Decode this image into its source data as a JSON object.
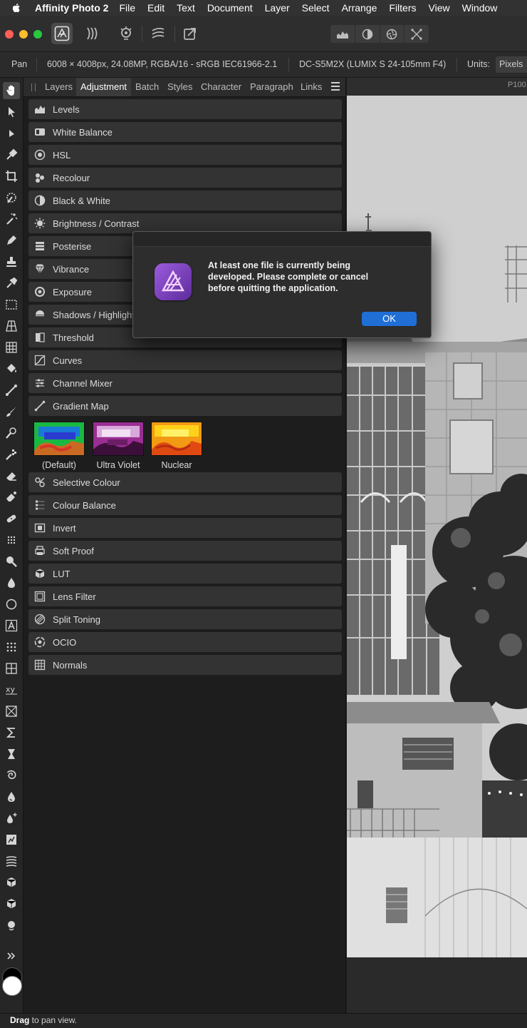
{
  "menubar": {
    "app_name": "Affinity Photo 2",
    "items": [
      "File",
      "Edit",
      "Text",
      "Document",
      "Layer",
      "Select",
      "Arrange",
      "Filters",
      "View",
      "Window"
    ]
  },
  "context": {
    "tool": "Pan",
    "doc_info": "6008 × 4008px, 24.08MP, RGBA/16 - sRGB IEC61966-2.1",
    "camera": "DC-S5M2X (LUMIX S 24-105mm F4)",
    "units_label": "Units:",
    "units_value": "Pixels"
  },
  "panel": {
    "tabs": [
      "Layers",
      "Adjustment",
      "Batch",
      "Styles",
      "Character",
      "Paragraph",
      "Links"
    ],
    "active_tab": "Adjustment",
    "adjustments": [
      {
        "label": "Levels",
        "icon": "levels-icon"
      },
      {
        "label": "White Balance",
        "icon": "white-balance-icon"
      },
      {
        "label": "HSL",
        "icon": "hsl-icon"
      },
      {
        "label": "Recolour",
        "icon": "recolour-icon"
      },
      {
        "label": "Black & White",
        "icon": "black-white-icon"
      },
      {
        "label": "Brightness / Contrast",
        "icon": "brightness-contrast-icon"
      },
      {
        "label": "Posterise",
        "icon": "posterise-icon"
      },
      {
        "label": "Vibrance",
        "icon": "vibrance-icon"
      },
      {
        "label": "Exposure",
        "icon": "exposure-icon"
      },
      {
        "label": "Shadows / Highlights",
        "icon": "shadows-highlights-icon"
      },
      {
        "label": "Threshold",
        "icon": "threshold-icon"
      },
      {
        "label": "Curves",
        "icon": "curves-icon"
      },
      {
        "label": "Channel Mixer",
        "icon": "channel-mixer-icon"
      },
      {
        "label": "Gradient Map",
        "icon": "gradient-map-icon"
      },
      {
        "label": "Selective Colour",
        "icon": "selective-colour-icon"
      },
      {
        "label": "Colour Balance",
        "icon": "colour-balance-icon"
      },
      {
        "label": "Invert",
        "icon": "invert-icon"
      },
      {
        "label": "Soft Proof",
        "icon": "soft-proof-icon"
      },
      {
        "label": "LUT",
        "icon": "lut-icon"
      },
      {
        "label": "Lens Filter",
        "icon": "lens-filter-icon"
      },
      {
        "label": "Split Toning",
        "icon": "split-toning-icon"
      },
      {
        "label": "OCIO",
        "icon": "ocio-icon"
      },
      {
        "label": "Normals",
        "icon": "normals-icon"
      }
    ],
    "gradient_presets": [
      "(Default)",
      "Ultra Violet",
      "Nuclear"
    ]
  },
  "canvas": {
    "zoom_label": "P100"
  },
  "status": {
    "strong": "Drag",
    "text": " to pan view."
  },
  "dialog": {
    "message": "At least one file is currently being developed. Please complete or cancel before quitting the application.",
    "ok_label": "OK"
  },
  "colors": {
    "accent": "#1f6fd6",
    "affinity_purple": "#8a4fd0"
  }
}
